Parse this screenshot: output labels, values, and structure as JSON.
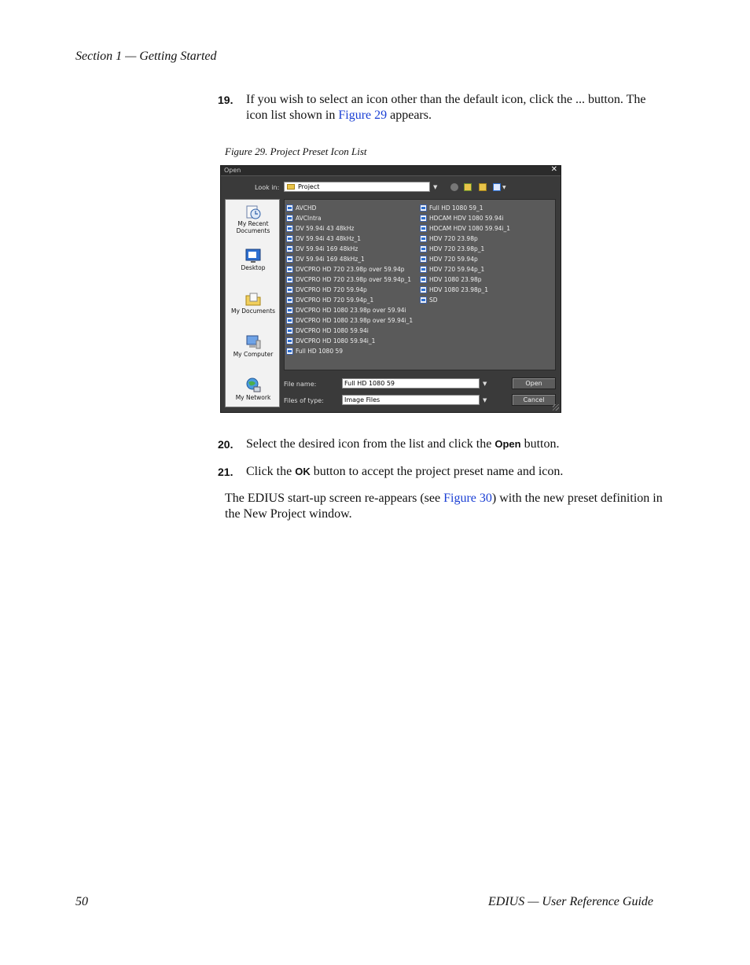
{
  "page": {
    "header": "Section 1 — Getting Started",
    "footer_page": "50",
    "footer_title": "EDIUS  —  User Reference Guide"
  },
  "steps": {
    "s19": {
      "num": "19.",
      "pre": "If you wish to select an icon other than the default icon, click the ... button. The icon list shown in ",
      "link": "Figure 29",
      "post": " appears."
    },
    "s20": {
      "num": "20.",
      "pre": "Select the desired icon from the list and click the ",
      "kw": "Open",
      "post": " button."
    },
    "s21": {
      "num": "21.",
      "pre": "Click the ",
      "kw": "OK",
      "post": " button to accept the project preset name and icon."
    },
    "para": {
      "pre": "The EDIUS start-up screen re-appears (see ",
      "link": "Figure 30",
      "post": ") with the new preset definition in the New Project window."
    }
  },
  "figure": {
    "caption": "Figure 29.  Project Preset Icon List",
    "dialog": {
      "title": "Open",
      "close_glyph": "✕",
      "look_in_label": "Look in:",
      "look_in_value": "Project",
      "places": [
        {
          "label": "My Recent\nDocuments",
          "icon": "recent-documents-icon"
        },
        {
          "label": "Desktop",
          "icon": "desktop-icon"
        },
        {
          "label": "My Documents",
          "icon": "my-documents-icon"
        },
        {
          "label": "My Computer",
          "icon": "my-computer-icon"
        },
        {
          "label": "My Network",
          "icon": "my-network-icon"
        }
      ],
      "files_col1": [
        "AVCHD",
        "AVCIntra",
        "DV 59.94i 43 48kHz",
        "DV 59.94i 43 48kHz_1",
        "DV 59.94i 169 48kHz",
        "DV 59.94i 169 48kHz_1",
        "DVCPRO HD 720 23.98p over 59.94p",
        "DVCPRO HD 720 23.98p over 59.94p_1",
        "DVCPRO HD 720 59.94p",
        "DVCPRO HD 720 59.94p_1",
        "DVCPRO HD 1080 23.98p over 59.94i",
        "DVCPRO HD 1080 23.98p over 59.94i_1",
        "DVCPRO HD 1080 59.94i",
        "DVCPRO HD 1080 59.94i_1",
        "Full HD 1080 59"
      ],
      "files_col2": [
        "Full HD 1080 59_1",
        "HDCAM HDV 1080 59.94i",
        "HDCAM HDV 1080 59.94i_1",
        "HDV 720 23.98p",
        "HDV 720 23.98p_1",
        "HDV 720 59.94p",
        "HDV 720 59.94p_1",
        "HDV 1080 23.98p",
        "HDV 1080 23.98p_1",
        "SD"
      ],
      "file_name_label": "File name:",
      "file_name_value": "Full HD 1080 59",
      "file_type_label": "Files of type:",
      "file_type_value": "Image Files",
      "open_label": "Open",
      "cancel_label": "Cancel"
    }
  }
}
